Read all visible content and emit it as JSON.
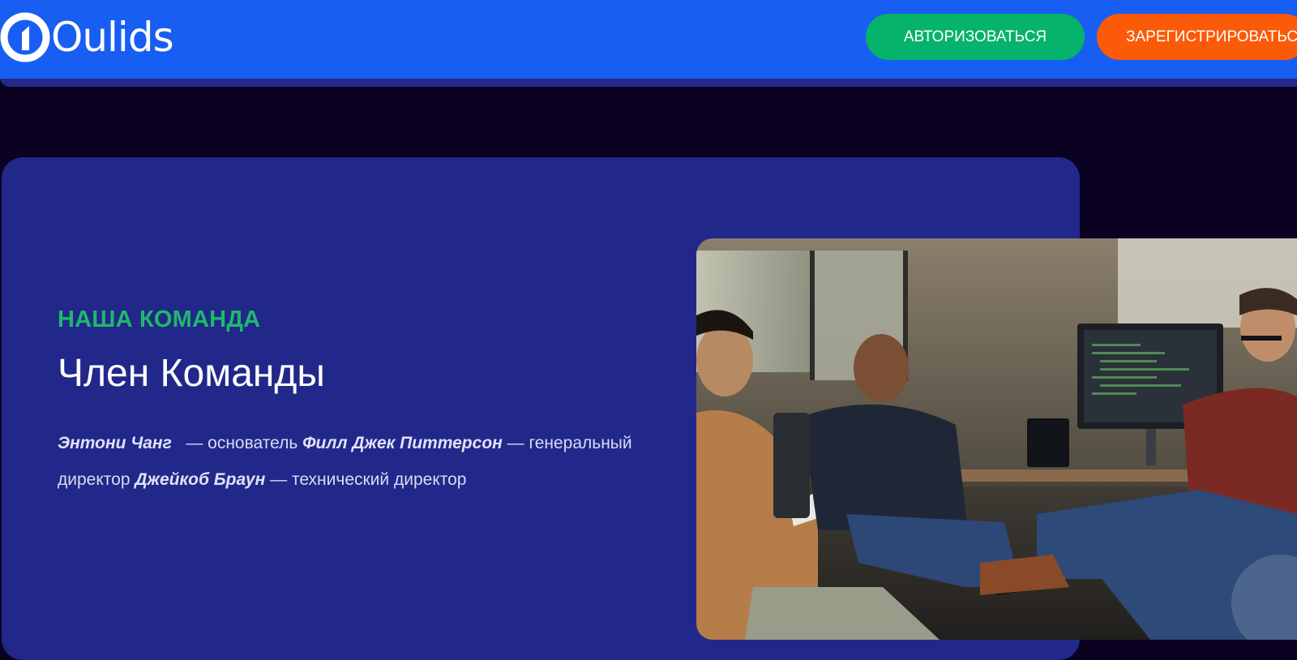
{
  "header": {
    "logo_text": "Oulids",
    "login_label": "АВТОРИЗОВАТЬСЯ",
    "register_label": "ЗАРЕГИСТРИРОВАТЬСЯ"
  },
  "team": {
    "eyebrow": "НАША КОМАНДА",
    "title": "Член Команды",
    "members": [
      {
        "name": "Энтони Чанг",
        "role": "— основатель"
      },
      {
        "name": "Филл Джек Питтерсон",
        "role": "— генеральный директор"
      },
      {
        "name": "Джейкоб Браун",
        "role": "— технический директор"
      }
    ]
  },
  "colors": {
    "header_bg": "#195ef3",
    "page_bg": "#0a0220",
    "card_bg": "#22288a",
    "accent_green": "#06b36a",
    "accent_orange": "#fb5a08",
    "eyebrow_green": "#1fb86b"
  },
  "icons": {
    "logo": "oulids-logo-icon"
  }
}
